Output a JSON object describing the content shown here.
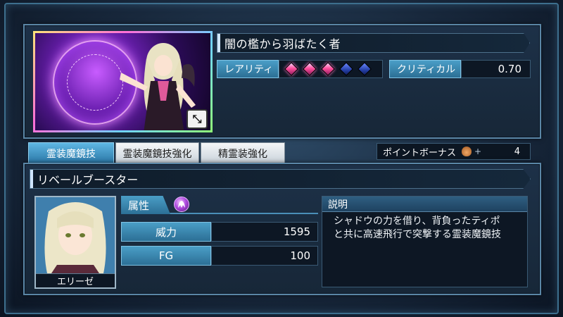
{
  "card": {
    "title": "闇の檻から羽ばたく者",
    "rarity_label": "レアリティ",
    "rarity": {
      "filled": 3,
      "total": 5
    },
    "critical_label": "クリティカル",
    "critical_value": "0.70",
    "expand_icon": "expand-arrows-icon"
  },
  "tabs": [
    {
      "label": "霊装魔鏡技",
      "active": true
    },
    {
      "label": "霊装魔鏡技強化",
      "active": false
    },
    {
      "label": "精霊装強化",
      "active": false
    }
  ],
  "bonus": {
    "label": "ポイントボーナス",
    "plus": "+",
    "value": "4"
  },
  "skill": {
    "name": "リベールブースター",
    "character_name": "エリーゼ",
    "attribute_label": "属性",
    "attribute_icon": "shadow-element-icon",
    "stats": [
      {
        "label": "威力",
        "value": "1595"
      },
      {
        "label": "FG",
        "value": "100"
      }
    ],
    "description_label": "説明",
    "description": "シャドウの力を借り、背負ったティポ\nと共に高速飛行で突撃する霊装魔鏡技"
  },
  "colors": {
    "accent_blue": "#2c6f95",
    "rarity_on": "#ff4f9c",
    "rarity_off": "#243ea6",
    "shadow_element": "#b04de0"
  }
}
